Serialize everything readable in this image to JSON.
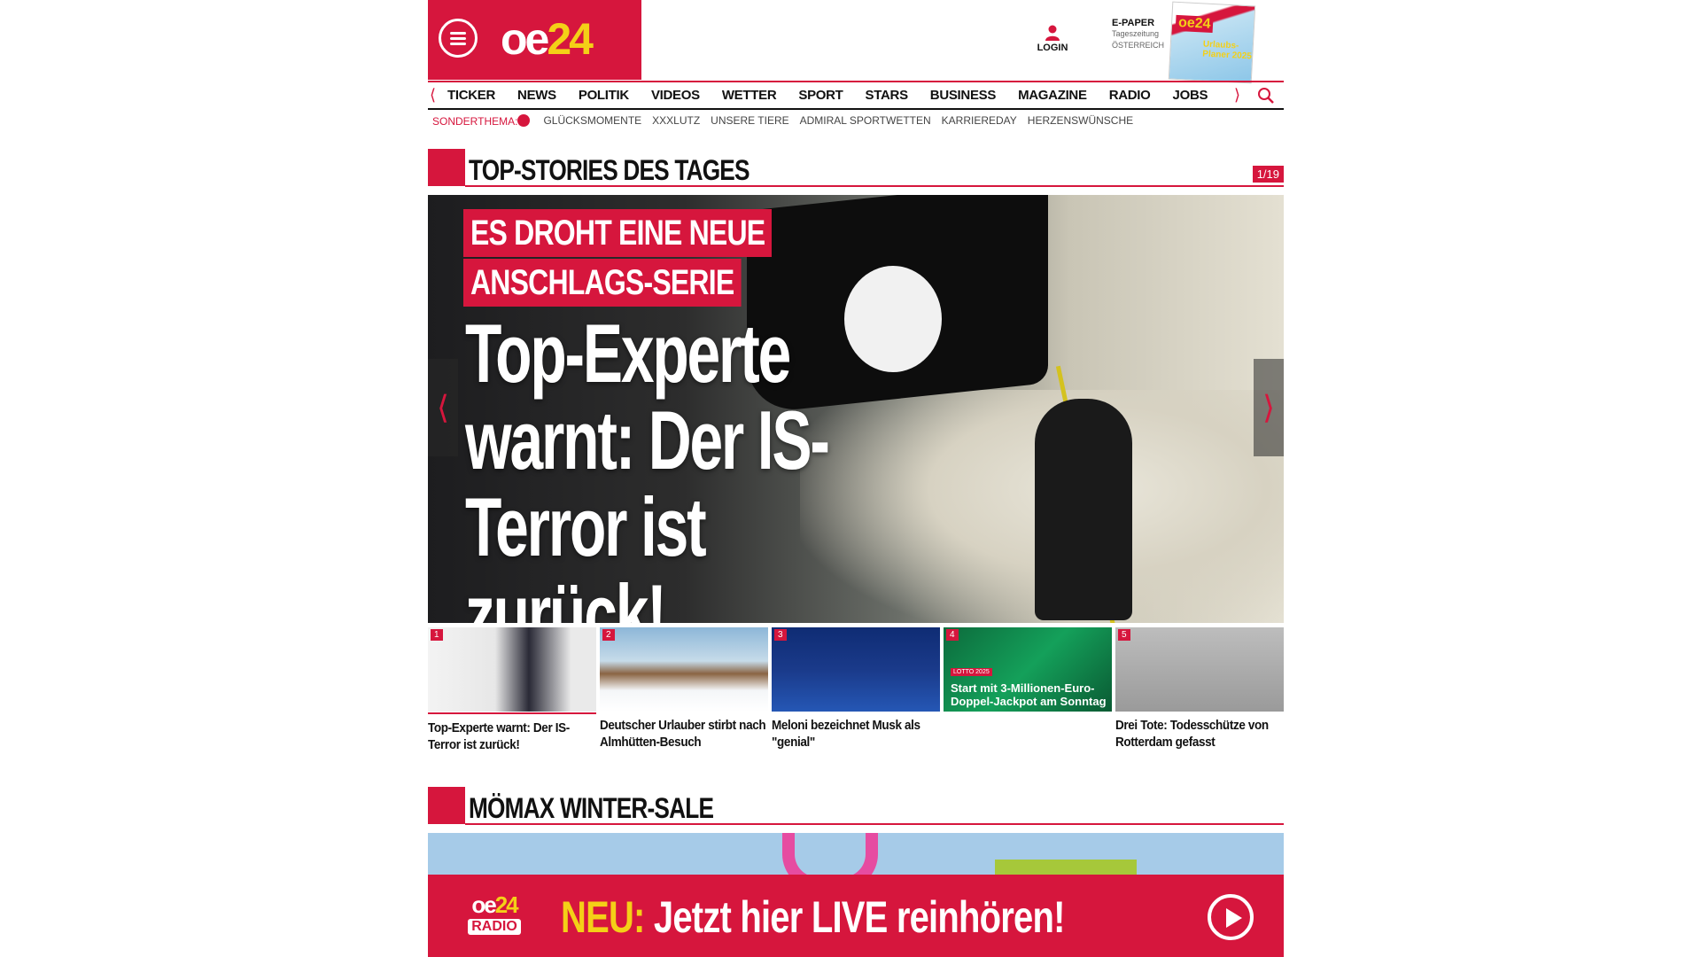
{
  "brand": {
    "logo_oe": "oe",
    "logo_24": "24",
    "accent": "#d6163d",
    "yellow": "#f4d017"
  },
  "header": {
    "login_label": "LOGIN",
    "epaper_title": "E-PAPER",
    "epaper_sub1": "Tageszeitung",
    "epaper_sub2": "ÖSTERREICH",
    "epaper_cover_logo": "oe24",
    "epaper_cover_text": "Urlaubs-Planer 2025"
  },
  "nav": {
    "items": [
      "TICKER",
      "NEWS",
      "POLITIK",
      "VIDEOS",
      "WETTER",
      "SPORT",
      "STARS",
      "BUSINESS",
      "MAGAZINE",
      "RADIO",
      "JOBS"
    ]
  },
  "subnav": {
    "label": "SONDERTHEMA:",
    "items": [
      "GLÜCKSMOMENTE",
      "XXXLUTZ",
      "UNSERE TIERE",
      "ADMIRAL SPORTWETTEN",
      "KARRIEREDAY",
      "HERZENSWÜNSCHE"
    ]
  },
  "top_stories": {
    "title": "TOP-STORIES DES TAGES",
    "counter": "1/19",
    "hero": {
      "kicker_line1": "ES DROHT EINE NEUE",
      "kicker_line2": "ANSCHLAGS-SERIE",
      "headline": "Top-Experte warnt: Der IS-Terror ist zurück!"
    },
    "teasers": [
      {
        "num": "1",
        "caption": "Top-Experte warnt: Der IS-Terror ist zurück!"
      },
      {
        "num": "2",
        "caption": "Deutscher Urlauber stirbt nach Almhütten-Besuch"
      },
      {
        "num": "3",
        "caption": "Meloni bezeichnet Musk als \"genial\""
      },
      {
        "num": "4",
        "caption": "",
        "thumb_tag": "LOTTO 2025",
        "thumb_caption": "Start mit 3-Millionen-Euro-Doppel-Jackpot am Sonntag"
      },
      {
        "num": "5",
        "caption": "Drei Tote: Todesschütze von Rotterdam gefasst"
      }
    ]
  },
  "promo": {
    "title": "MÖMAX WINTER-SALE"
  },
  "radio": {
    "logo_top_oe": "oe",
    "logo_top_24": "24",
    "logo_bottom": "RADIO",
    "neu": "NEU:",
    "text": "Jetzt hier LIVE reinhören!"
  }
}
